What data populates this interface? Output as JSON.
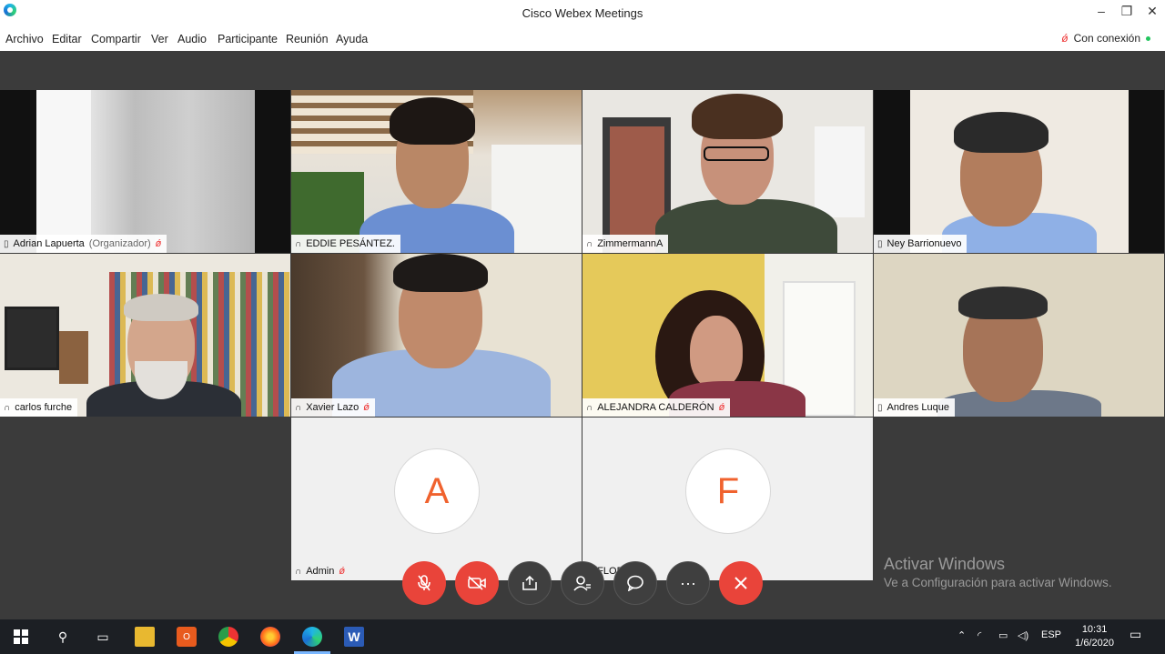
{
  "window": {
    "title": "Cisco Webex Meetings",
    "controls": [
      "minimize-icon",
      "restore-icon",
      "close-icon"
    ]
  },
  "menu": {
    "items": [
      "Archivo",
      "Editar",
      "Compartir",
      "Ver",
      "Audio",
      "Participante",
      "Reunión",
      "Ayuda"
    ],
    "connection_status": "Con conexión"
  },
  "participants": [
    {
      "name": "Adrian Lapuerta",
      "role": "(Organizador)",
      "device": "phone",
      "muted": true
    },
    {
      "name": "EDDIE PESÁNTEZ.",
      "role": "",
      "device": "headset",
      "muted": false
    },
    {
      "name": "ZimmermannA",
      "role": "",
      "device": "headset",
      "muted": false,
      "active_speaker": true
    },
    {
      "name": "Ney Barrionuevo",
      "role": "",
      "device": "phone",
      "muted": false
    },
    {
      "name": "carlos furche",
      "role": "",
      "device": "headset",
      "muted": false
    },
    {
      "name": "Xavier Lazo",
      "role": "",
      "device": "headset",
      "muted": true
    },
    {
      "name": "ALEJANDRA CALDERÓN",
      "role": "",
      "device": "headset",
      "muted": true
    },
    {
      "name": "Andres Luque",
      "role": "",
      "device": "phone",
      "muted": false
    },
    {
      "name": "Admin",
      "role": "",
      "device": "headset",
      "muted": true,
      "avatar_letter": "A"
    },
    {
      "name": "FLORES",
      "role": "",
      "device": "headset",
      "muted": true,
      "avatar_letter": "F"
    }
  ],
  "controls": [
    {
      "name": "mute-button",
      "icon": "microphone-off-icon"
    },
    {
      "name": "video-button",
      "icon": "video-off-icon"
    },
    {
      "name": "share-button",
      "icon": "share-icon"
    },
    {
      "name": "participants-button",
      "icon": "participants-icon"
    },
    {
      "name": "chat-button",
      "icon": "chat-icon"
    },
    {
      "name": "more-button",
      "icon": "more-icon"
    },
    {
      "name": "end-meeting-button",
      "icon": "close-icon"
    }
  ],
  "watermark": {
    "line1": "Activar Windows",
    "line2": "Ve a Configuración para activar Windows."
  },
  "taskbar": {
    "lang": "ESP",
    "time": "10:31",
    "date": "1/6/2020"
  },
  "colors": {
    "accent": "#2aa6e6",
    "end_call": "#e9443a",
    "avatar_letter": "#f0622e"
  }
}
